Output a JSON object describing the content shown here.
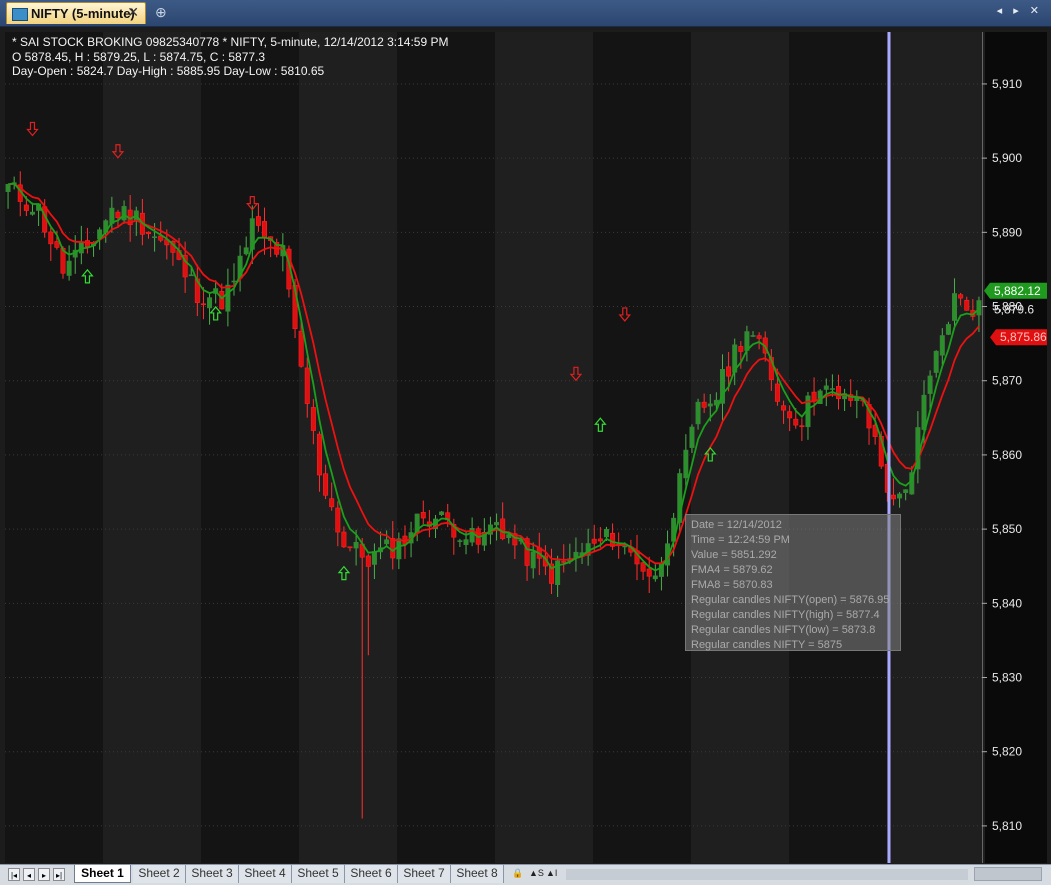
{
  "window": {
    "tab_title": "NIFTY (5-minute)",
    "close_glyph": "✕",
    "new_tab_glyph": "⊕",
    "nav_glyphs": "◂ ▸ ✕"
  },
  "info": {
    "line1": "* SAI STOCK BROKING 09825340778 *  NIFTY, 5-minute, 12/14/2012 3:14:59 PM",
    "line2": "O 5878.45,   H :  5879.25,   L  :  5874.75,   C  :  5877.3",
    "line3": " Day-Open : 5824.7  Day-High : 5885.95  Day-Low : 5810.65"
  },
  "tooltip": {
    "date": "Date = 12/14/2012",
    "time": "Time = 12:24:59 PM",
    "value": "Value = 5851.292",
    "fma4": "FMA4 = 5879.62",
    "fma8": "FMA8 = 5870.83",
    "open": "Regular candles NIFTY(open) = 5876.95",
    "high": "Regular candles NIFTY(high) = 5877.4",
    "low": "Regular candles NIFTY(low) = 5873.8",
    "close": "Regular candles NIFTY = 5875"
  },
  "colors": {
    "background": "#0a0a0a",
    "band_dark": "#141414",
    "band_light": "#1f1f1f",
    "up_candle": "#2b8f2b",
    "down_candle": "#e01010",
    "fma4_line": "#1aa01a",
    "fma8_line": "#ee1111",
    "buy_arrow": "#33dd33",
    "sell_arrow": "#e02020",
    "cursor": "#a9a9ff"
  },
  "sheets": {
    "tabs": [
      "Sheet 1",
      "Sheet 2",
      "Sheet 3",
      "Sheet 4",
      "Sheet 5",
      "Sheet 6",
      "Sheet 7",
      "Sheet 8"
    ],
    "active_index": 0,
    "nav_glyphs": [
      "|◂",
      "◂",
      "▸",
      "▸|"
    ],
    "tools": [
      "🔒",
      "▲S",
      "▲I"
    ]
  },
  "chart_data": {
    "type": "candlestick",
    "symbol": "NIFTY",
    "interval": "5-minute",
    "ylim": [
      5805,
      5917
    ],
    "y_ticks": [
      5810,
      5820,
      5830,
      5840,
      5850,
      5860,
      5870,
      5880,
      5890,
      5900,
      5910
    ],
    "y_tick_labels": [
      "5,810",
      "5,820",
      "5,830",
      "5,840",
      "5,850",
      "5,860",
      "5,870",
      "5,880",
      "5,890",
      "5,900",
      "5,910"
    ],
    "last_price_label": "5,879.6",
    "fma4_last_label": "5,882.12",
    "fma8_last_label": "5,875.86",
    "fma4_last": 5882.12,
    "fma8_last": 5875.86,
    "cursor_bar": 120,
    "bar_count": 122,
    "candle_anchors": [
      [
        0,
        5896
      ],
      [
        5,
        5893
      ],
      [
        9,
        5885
      ],
      [
        13,
        5888
      ],
      [
        17,
        5893
      ],
      [
        21,
        5892
      ],
      [
        26,
        5888
      ],
      [
        31,
        5882
      ],
      [
        35,
        5881
      ],
      [
        37,
        5883
      ],
      [
        40,
        5891
      ],
      [
        42,
        5889
      ],
      [
        45,
        5887
      ],
      [
        47,
        5876
      ],
      [
        51,
        5858
      ],
      [
        55,
        5848
      ],
      [
        59,
        5846
      ],
      [
        64,
        5848
      ],
      [
        68,
        5852
      ],
      [
        72,
        5851
      ],
      [
        77,
        5848
      ],
      [
        80,
        5851
      ],
      [
        84,
        5847
      ],
      [
        89,
        5844
      ],
      [
        94,
        5847
      ],
      [
        99,
        5849
      ],
      [
        103,
        5846
      ],
      [
        106,
        5843
      ],
      [
        110,
        5856
      ],
      [
        113,
        5866
      ],
      [
        116,
        5868
      ],
      [
        119,
        5874
      ],
      [
        121,
        5877
      ],
      [
        124,
        5873
      ],
      [
        127,
        5866
      ],
      [
        130,
        5865
      ],
      [
        133,
        5870
      ],
      [
        136,
        5867
      ],
      [
        139,
        5868
      ],
      [
        142,
        5862
      ],
      [
        145,
        5853
      ],
      [
        148,
        5858
      ],
      [
        150,
        5867
      ],
      [
        153,
        5876
      ],
      [
        155,
        5881
      ],
      [
        157,
        5880
      ]
    ],
    "arrows": [
      {
        "bar": 4,
        "type": "sell",
        "price": 5904
      },
      {
        "bar": 13,
        "type": "buy",
        "price": 5884
      },
      {
        "bar": 18,
        "type": "sell",
        "price": 5901
      },
      {
        "bar": 34,
        "type": "buy",
        "price": 5879
      },
      {
        "bar": 40,
        "type": "sell",
        "price": 5894
      },
      {
        "bar": 55,
        "type": "buy",
        "price": 5844
      },
      {
        "bar": 93,
        "type": "sell",
        "price": 5871
      },
      {
        "bar": 97,
        "type": "buy",
        "price": 5864
      },
      {
        "bar": 101,
        "type": "sell",
        "price": 5879
      },
      {
        "bar": 115,
        "type": "buy",
        "price": 5860
      }
    ],
    "wick_extremes": [
      {
        "bar": 58,
        "low": 5811,
        "high": 5846
      },
      {
        "bar": 59,
        "low": 5833,
        "high": 5845
      }
    ]
  }
}
